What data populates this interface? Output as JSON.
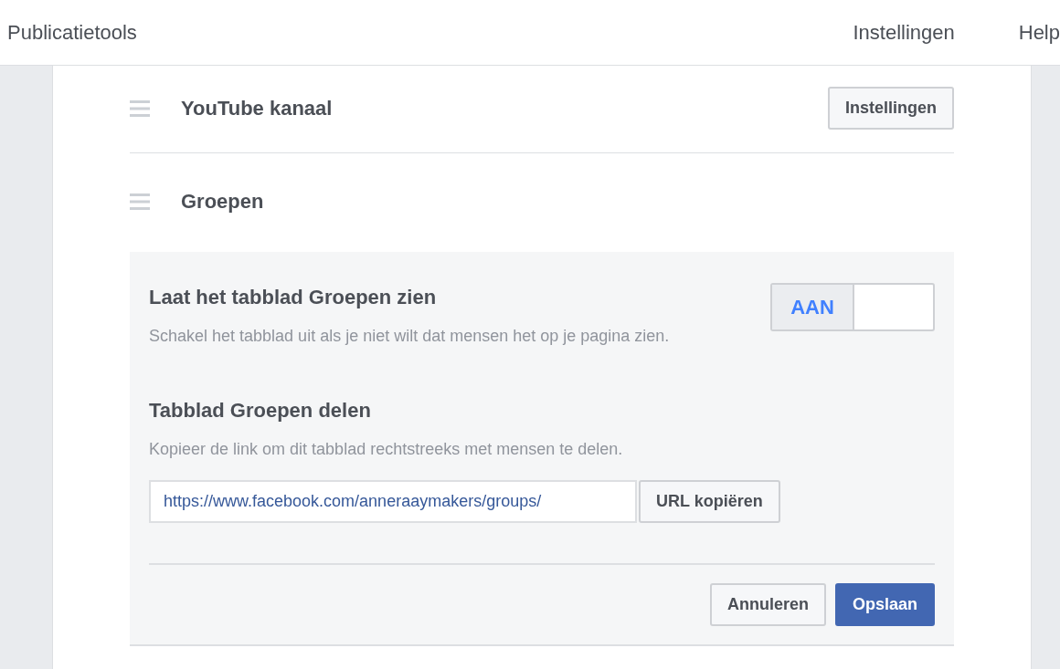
{
  "top_bar": {
    "title": "Publicatietools",
    "links": [
      {
        "label": "Instellingen"
      },
      {
        "label": "Help"
      }
    ]
  },
  "sections": [
    {
      "title": "YouTube kanaal",
      "expanded": false,
      "button": "Instellingen"
    },
    {
      "title": "Groepen",
      "expanded": true
    }
  ],
  "panel": {
    "toggle_setting": {
      "title": "Laat het tabblad Groepen zien",
      "description": "Schakel het tabblad uit als je niet wilt dat mensen het op je pagina zien.",
      "toggle": {
        "label": "AAN",
        "on": true
      }
    },
    "share": {
      "title": "Tabblad Groepen delen",
      "description": "Kopieer de link om dit tabblad rechtstreeks met mensen te delen.",
      "url": "https://www.facebook.com/anneraaymakers/groups/",
      "copy_button": "URL kopiëren"
    },
    "buttons": [
      {
        "label": "Annuleren",
        "primary": false
      },
      {
        "label": "Opslaan",
        "primary": true
      }
    ]
  }
}
